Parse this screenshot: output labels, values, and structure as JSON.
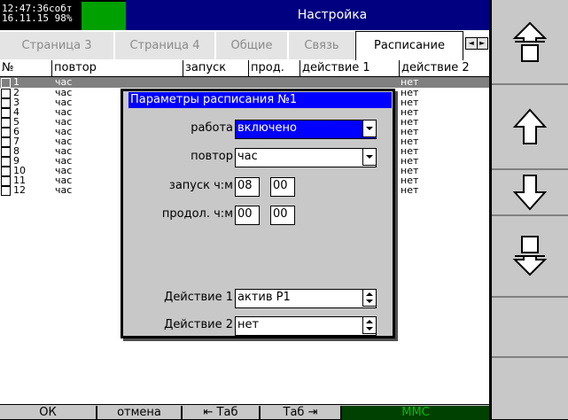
{
  "status": {
    "time": "12:47:36",
    "event": "собт",
    "date": "16.11.15",
    "battery": "98%"
  },
  "title": "Настройка",
  "tabs": [
    {
      "label": "Страница 3"
    },
    {
      "label": "Страница 4"
    },
    {
      "label": "Общие"
    },
    {
      "label": "Связь"
    },
    {
      "label": "Расписание"
    }
  ],
  "tab_scroll": {
    "left": "◄",
    "right": "►"
  },
  "table": {
    "headers": [
      "№",
      "повтор",
      "запуск",
      "прод.",
      "действие 1",
      "действие 2"
    ],
    "rows": [
      {
        "num": "1",
        "repeat": "час",
        "action1": "нет"
      },
      {
        "num": "2",
        "repeat": "час",
        "action1": "нет"
      },
      {
        "num": "3",
        "repeat": "час",
        "action1": "нет"
      },
      {
        "num": "4",
        "repeat": "час",
        "action1": "нет"
      },
      {
        "num": "5",
        "repeat": "час",
        "action1": "нет"
      },
      {
        "num": "6",
        "repeat": "час",
        "action1": "нет"
      },
      {
        "num": "7",
        "repeat": "час",
        "action1": "нет"
      },
      {
        "num": "8",
        "repeat": "час",
        "action1": "нет"
      },
      {
        "num": "9",
        "repeat": "час",
        "action1": "нет"
      },
      {
        "num": "10",
        "repeat": "час",
        "action1": "нет"
      },
      {
        "num": "11",
        "repeat": "час",
        "action1": "нет"
      },
      {
        "num": "12",
        "repeat": "час",
        "action1": "нет"
      }
    ]
  },
  "dialog": {
    "title": "Параметры расписания №1",
    "work_label": "работа",
    "work_value": "включено",
    "repeat_label": "повтор",
    "repeat_value": "час",
    "start_label": "запуск ч:м",
    "start_hours": "08",
    "start_minutes": "00",
    "duration_label": "продол. ч:м",
    "duration_hours": "00",
    "duration_minutes": "00",
    "action1_label": "Действие 1",
    "action1_value": "актив Р1",
    "action2_label": "Действие 2",
    "action2_value": "нет"
  },
  "bottom_bar": {
    "ok": "ОК",
    "cancel": "отмена",
    "tab_back": "⇤ Таб",
    "tab_forward": "Таб ⇥",
    "mmc": "MMC"
  },
  "side_buttons": [
    "page-up-icon",
    "arrow-up-icon",
    "arrow-down-icon",
    "page-down-icon"
  ],
  "colors": {
    "title_bg": "#000080",
    "dialog_title_bg": "#0000ff",
    "highlight": "#0000ff",
    "selected_row": "#808080",
    "status_indicator": "#00a000",
    "mmc_text": "#00c000",
    "panel": "#c8c8c8"
  }
}
